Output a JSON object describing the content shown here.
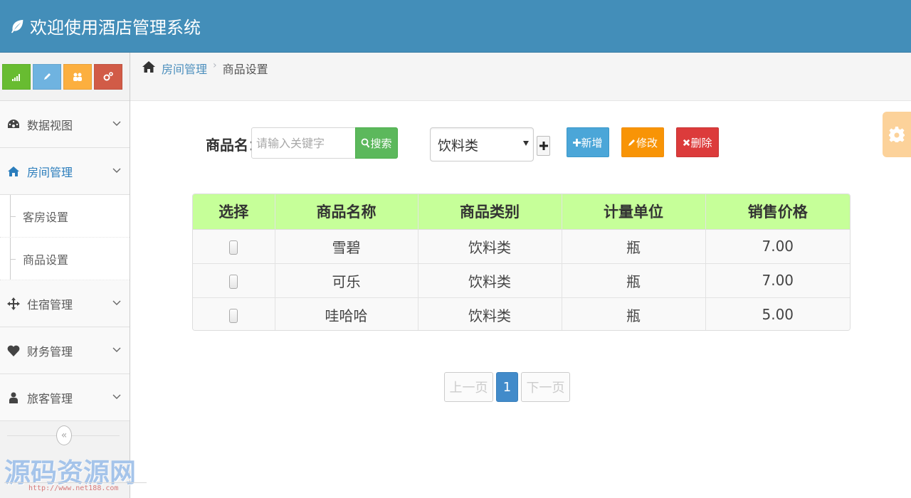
{
  "header": {
    "title": "欢迎使用酒店管理系统"
  },
  "sidebar": {
    "shortcuts": [
      {
        "name": "signal-icon",
        "color": "#68bc31"
      },
      {
        "name": "pencil-icon",
        "color": "#6fb3e0"
      },
      {
        "name": "group-icon",
        "color": "#fcaf3f"
      },
      {
        "name": "cogs-icon",
        "color": "#d15b47"
      }
    ],
    "items": [
      {
        "label": "数据视图",
        "icon": "dashboard-icon"
      },
      {
        "label": "房间管理",
        "icon": "home-icon",
        "active": true
      },
      {
        "label": "住宿管理",
        "icon": "move-icon"
      },
      {
        "label": "财务管理",
        "icon": "heart-icon"
      },
      {
        "label": "旅客管理",
        "icon": "user-icon"
      }
    ],
    "subitems": [
      {
        "label": "客房设置"
      },
      {
        "label": "商品设置"
      }
    ],
    "collapse_glyph": "«"
  },
  "breadcrumb": {
    "parent": "房间管理",
    "separator": "›",
    "current": "商品设置"
  },
  "toolbar": {
    "product_label": "商品名：",
    "search_placeholder": "请输入关键字",
    "search_button": "搜索",
    "category_selected": "饮料类",
    "add_button": "新增",
    "edit_button": "修改",
    "delete_button": "删除"
  },
  "table": {
    "headers": [
      "选择",
      "商品名称",
      "商品类别",
      "计量单位",
      "销售价格"
    ],
    "rows": [
      {
        "name": "雪碧",
        "category": "饮料类",
        "unit": "瓶",
        "price": "7.00"
      },
      {
        "name": "可乐",
        "category": "饮料类",
        "unit": "瓶",
        "price": "7.00"
      },
      {
        "name": "哇哈哈",
        "category": "饮料类",
        "unit": "瓶",
        "price": "5.00"
      }
    ]
  },
  "pagination": {
    "prev": "上一页",
    "current": "1",
    "next": "下一页"
  },
  "watermark": {
    "text": "源码资源网",
    "url": "http://www.net188.com"
  },
  "colors": {
    "header": "#438eb9",
    "table_header": "#c6ff99",
    "search": "#5cb85c",
    "add": "#4ba6d8",
    "edit": "#f89406",
    "delete": "#dc3b3b",
    "page_active": "#428bca"
  }
}
